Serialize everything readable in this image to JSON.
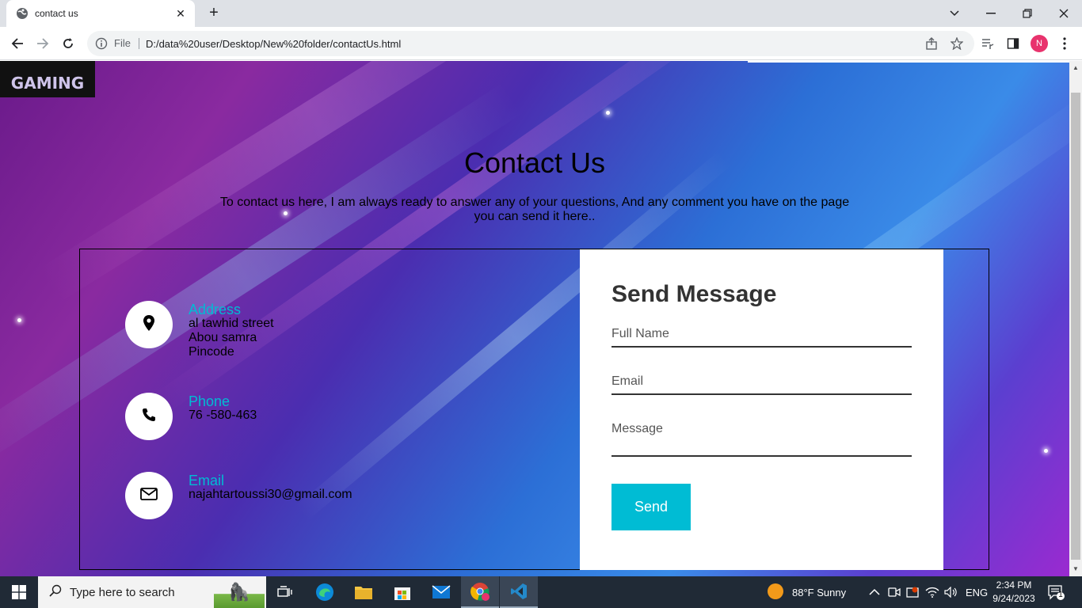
{
  "browser": {
    "tab_title": "contact us",
    "new_tab": "+",
    "close_tab": "✕",
    "address_label": "File",
    "url": "D:/data%20user/Desktop/New%20folder/contactUs.html",
    "profile_initial": "N"
  },
  "page": {
    "logo_text": "GAMING",
    "heading": "Contact Us",
    "intro": "To contact us here, I am always ready to answer any of your questions, And any comment you have on the page you can send it here..",
    "info": [
      {
        "title": "Address",
        "lines": [
          "al tawhid street",
          "Abou samra",
          "Pincode"
        ]
      },
      {
        "title": "Phone",
        "lines": [
          "76 -580-463"
        ]
      },
      {
        "title": "Email",
        "lines": [
          "najahtartoussi30@gmail.com"
        ]
      }
    ],
    "form": {
      "title": "Send Message",
      "full_name_label": "Full Name",
      "email_label": "Email",
      "message_label": "Message",
      "send_label": "Send"
    }
  },
  "taskbar": {
    "search_placeholder": "Type here to search",
    "weather": "88°F  Sunny",
    "language": "ENG",
    "time": "2:34 PM",
    "date": "9/24/2023",
    "notification_count": "1"
  },
  "colors": {
    "accent": "#00bcd4",
    "taskbar": "#202a36",
    "tab_strip": "#dee1e6"
  }
}
